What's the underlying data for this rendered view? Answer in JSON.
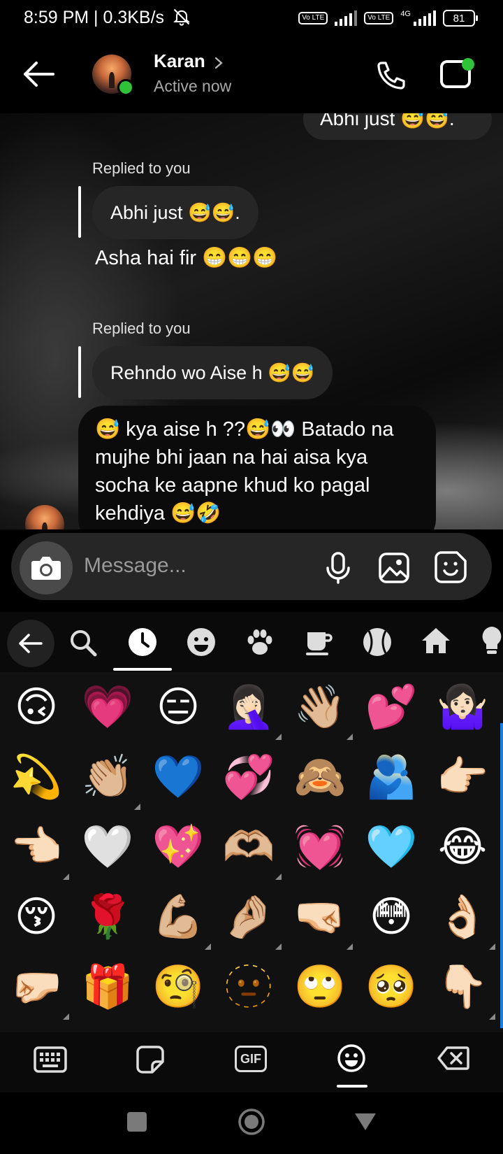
{
  "status_bar": {
    "time_speed": "8:59 PM | 0.3KB/s",
    "lte1": "Vo LTE",
    "lte2": "Vo LTE",
    "net": "4G",
    "battery": "81"
  },
  "header": {
    "contact_name": "Karan",
    "status": "Active now"
  },
  "messages": {
    "partial_sent": "Abhi just 😅😅.",
    "replied_label_1": "Replied to you",
    "reply_quote_1": "Abhi just 😅😅.",
    "msg_1": "Asha hai fir 😁😁😁",
    "replied_label_2": "Replied to you",
    "reply_quote_2": "Rehndo wo Aise h 😅😅",
    "msg_2_line1": "😅 kya aise h ??😅👀 Batado na",
    "msg_2_line2": "mujhe bhi jaan na hai aisa kya",
    "msg_2_line3": "socha ke aapne khud ko pagal",
    "msg_2_line4": "kehdiya 😅🤣"
  },
  "composer": {
    "placeholder": "Message..."
  },
  "emoji_keyboard": {
    "rows": [
      [
        "🙃",
        "💗",
        "😑",
        "🤦🏻‍♀️",
        "👋🏼",
        "💕",
        "🤷🏻‍♀️"
      ],
      [
        "💫",
        "👏🏼",
        "💙",
        "💞",
        "🙈",
        "🫂",
        "👉🏻"
      ],
      [
        "👈🏻",
        "🤍",
        "💖",
        "🫶🏼",
        "💓",
        "🩵",
        "😂"
      ],
      [
        "😚",
        "🌹",
        "💪🏼",
        "🤌🏼",
        "🤜🏻",
        "😳",
        "👌🏻"
      ],
      [
        "🤛🏻",
        "🎁",
        "🧐",
        "🫥",
        "🙄",
        "🥺",
        "👇🏻"
      ]
    ],
    "has_variants": [
      [
        false,
        false,
        false,
        true,
        true,
        false,
        false
      ],
      [
        false,
        true,
        false,
        false,
        false,
        false,
        false
      ],
      [
        true,
        false,
        false,
        true,
        false,
        false,
        false
      ],
      [
        false,
        false,
        true,
        true,
        true,
        false,
        true
      ],
      [
        true,
        false,
        false,
        false,
        false,
        false,
        true
      ]
    ],
    "categories": [
      "back-icon",
      "search-icon",
      "recent-clock-icon",
      "smiley-icon",
      "paw-icon",
      "cup-icon",
      "ball-icon",
      "house-icon",
      "bulb-icon"
    ],
    "selected_category": "recent-clock-icon",
    "bottom_tabs": [
      "keyboard-icon",
      "sticker-icon",
      "GIF",
      "emoji-icon",
      "backspace-icon"
    ],
    "gif_label": "GIF",
    "selected_bottom_tab": "emoji-icon"
  }
}
